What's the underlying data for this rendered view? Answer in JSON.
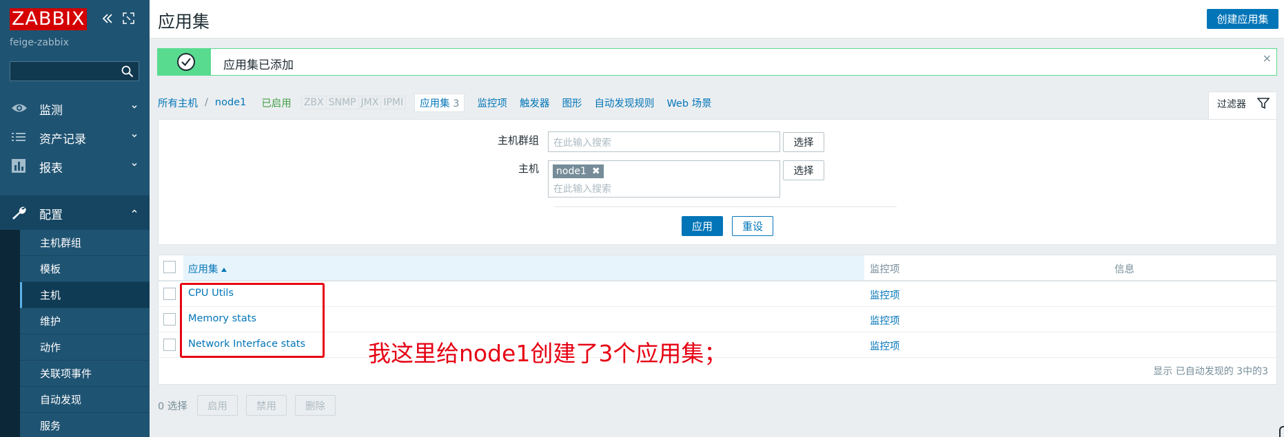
{
  "app": {
    "logo": "ZABBIX",
    "server_name": "feige-zabbix"
  },
  "sidebar": {
    "search_value": "",
    "menu": [
      {
        "label": "监测",
        "icon": "eye-icon"
      },
      {
        "label": "资产记录",
        "icon": "list-icon"
      },
      {
        "label": "报表",
        "icon": "bar-chart-icon"
      },
      {
        "label": "配置",
        "icon": "wrench-icon"
      }
    ],
    "submenu": [
      {
        "label": "主机群组"
      },
      {
        "label": "模板"
      },
      {
        "label": "主机"
      },
      {
        "label": "维护"
      },
      {
        "label": "动作"
      },
      {
        "label": "关联项事件"
      },
      {
        "label": "自动发现"
      },
      {
        "label": "服务"
      }
    ]
  },
  "header": {
    "title": "应用集",
    "create_label": "创建应用集"
  },
  "message": {
    "text": "应用集已添加",
    "close": "×"
  },
  "nav": {
    "all_hosts": "所有主机",
    "separator": "/",
    "host": "node1",
    "status": "已启用",
    "availability": [
      "ZBX",
      "SNMP",
      "JMX",
      "IPMI"
    ],
    "current_tab": "应用集",
    "current_count": "3",
    "tabs": [
      "监控项",
      "触发器",
      "图形",
      "自动发现规则",
      "Web 场景"
    ]
  },
  "filter": {
    "tab_label": "过滤器",
    "host_group_label": "主机群组",
    "host_group_placeholder": "在此输入搜索",
    "host_label": "主机",
    "host_tag": "node1",
    "host_placeholder": "在此输入搜索",
    "select_label": "选择",
    "apply_label": "应用",
    "reset_label": "重设"
  },
  "table": {
    "columns": [
      "应用集",
      "监控项",
      "信息"
    ],
    "rows": [
      {
        "name": "CPU Utils",
        "items": "监控项"
      },
      {
        "name": "Memory stats",
        "items": "监控项"
      },
      {
        "name": "Network Interface stats",
        "items": "监控项"
      }
    ],
    "footer": "显示 已自动发现的 3中的3"
  },
  "annotation": {
    "text": "我这里给node1创建了3个应用集；",
    "color": "#e60012"
  },
  "mass_actions": {
    "selected": "0 选择",
    "buttons": [
      "启用",
      "禁用",
      "删除"
    ]
  },
  "colors": {
    "sidebar": "#1f5372",
    "accent": "#0275b8",
    "success": "#59db8f",
    "logo": "#d40000"
  }
}
